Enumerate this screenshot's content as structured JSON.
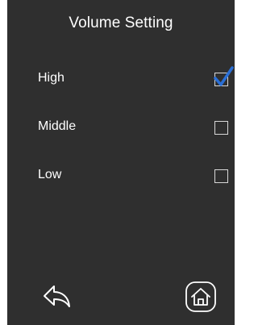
{
  "header": {
    "title": "Volume Setting"
  },
  "options": [
    {
      "label": "High",
      "checked": true
    },
    {
      "label": "Middle",
      "checked": false
    },
    {
      "label": "Low",
      "checked": false
    }
  ],
  "footer": {
    "back_icon": "back-arrow-icon",
    "home_icon": "home-icon"
  },
  "colors": {
    "background": "#2f2f2f",
    "text": "#ffffff",
    "checkmark": "#2a6fd6",
    "checkbox_border": "#d8d8d8"
  }
}
